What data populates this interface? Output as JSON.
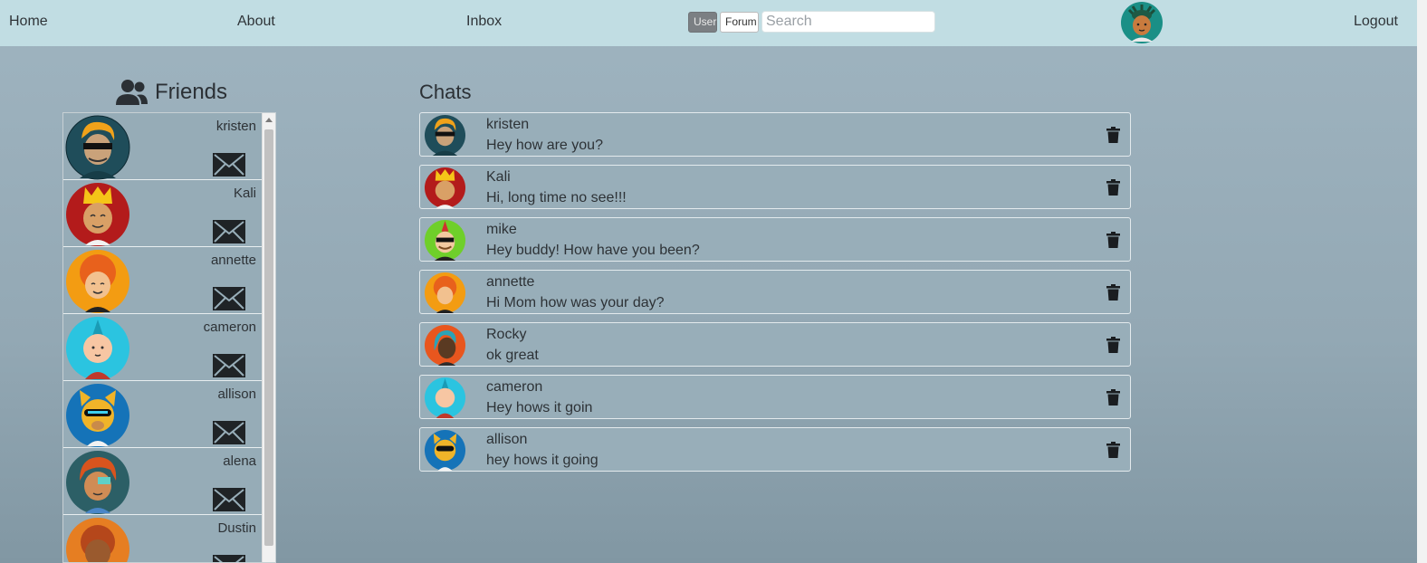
{
  "nav": {
    "home": "Home",
    "about": "About",
    "inbox": "Inbox",
    "toggle_user": "User",
    "toggle_forum": "Forum",
    "search_placeholder": "Search",
    "logout": "Logout"
  },
  "friends": {
    "title": "Friends",
    "items": [
      {
        "name": "kristen"
      },
      {
        "name": "Kali"
      },
      {
        "name": "annette"
      },
      {
        "name": "cameron"
      },
      {
        "name": "allison"
      },
      {
        "name": "alena"
      },
      {
        "name": "Dustin"
      }
    ]
  },
  "chats": {
    "title": "Chats",
    "items": [
      {
        "name": "kristen",
        "message": "Hey how are you?"
      },
      {
        "name": "Kali",
        "message": "Hi, long time no see!!!"
      },
      {
        "name": "mike",
        "message": "Hey buddy! How have you been?"
      },
      {
        "name": "annette",
        "message": "Hi Mom how was your day?"
      },
      {
        "name": "Rocky",
        "message": "ok great"
      },
      {
        "name": "cameron",
        "message": "Hey hows it goin"
      },
      {
        "name": "allison",
        "message": "hey hows it going"
      }
    ]
  },
  "colors": {
    "navbar": "#c1dde3",
    "background": "#9fb4c0"
  }
}
